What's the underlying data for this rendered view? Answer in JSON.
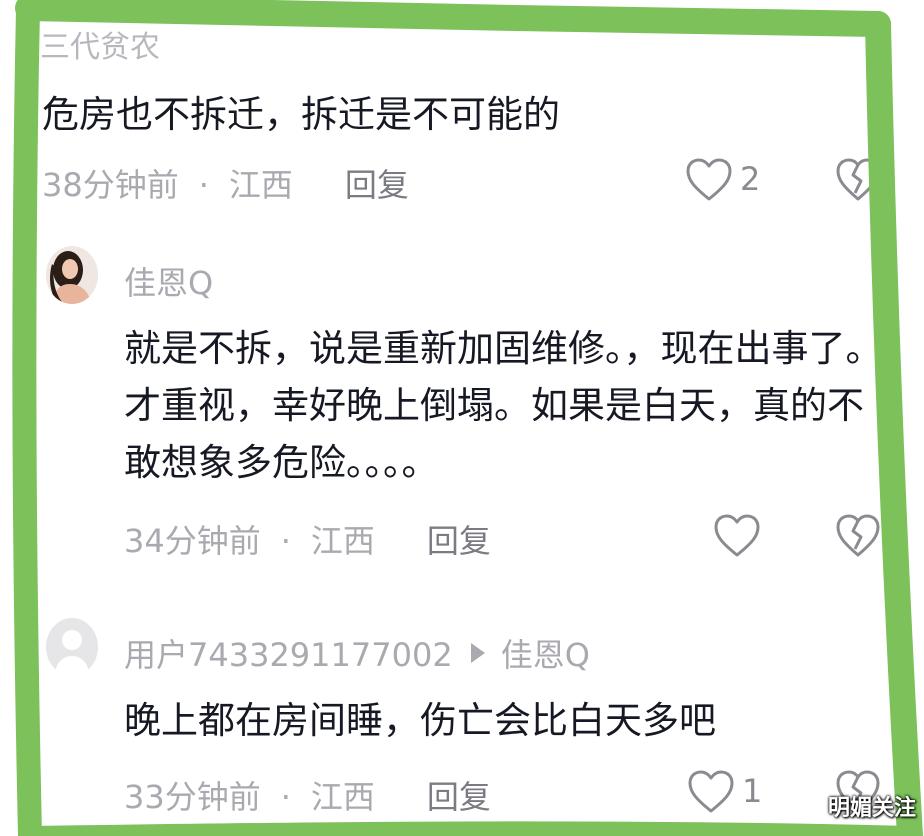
{
  "comments": [
    {
      "author_partial": "三代贫农",
      "text": "危房也不拆迁，拆迁是不可能的",
      "time": "38分钟前",
      "location": "江西",
      "reply_label": "回复",
      "likes": "2"
    },
    {
      "author": "佳恩Q",
      "text": "就是不拆，说是重新加固维修。，现在出事了。才重视，幸好晚上倒塌。如果是白天，真的不敢想象多危险。。。。",
      "time": "34分钟前",
      "location": "江西",
      "reply_label": "回复"
    },
    {
      "author": "用户7433291177002",
      "reply_to": "佳恩Q",
      "text": "晚上都在房间睡，伤亡会比白天多吧",
      "time": "33分钟前",
      "location": "江西",
      "reply_label": "回复",
      "likes": "1"
    }
  ],
  "separator": "·",
  "watermark": "明媚关注",
  "colors": {
    "frame": "#7cc15a",
    "primary_text": "#161823",
    "secondary_text": "#a9aab0"
  },
  "icons": {
    "like": "heart-outline-icon",
    "dislike": "broken-heart-icon",
    "reply_arrow": "triangle-right-icon",
    "default_avatar": "default-user-avatar"
  }
}
